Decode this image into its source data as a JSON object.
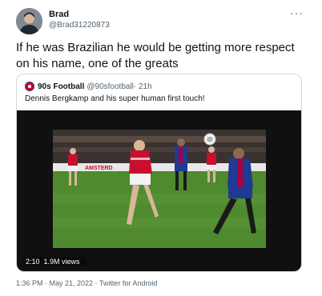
{
  "tweet": {
    "author_name": "Brad",
    "author_handle": "@Brad31220873",
    "more_label": "···",
    "text": "If he was Brazilian he would be getting more respect on his name, one of the greats",
    "footer": "1:36 PM · May 21, 2022 · Twitter for Android"
  },
  "quote": {
    "author_name": "90s Football",
    "author_handle": "@90sfootball",
    "time": "· 21h",
    "text": "Dennis Bergkamp and his super human first touch!",
    "video": {
      "duration": "2:10",
      "views": "1.9M views",
      "board_text": "AMSTERD"
    }
  },
  "colors": {
    "arsenal_red": "#c8102e",
    "barca_blue": "#1f3a93",
    "pitch_green": "#4f8a2f"
  }
}
